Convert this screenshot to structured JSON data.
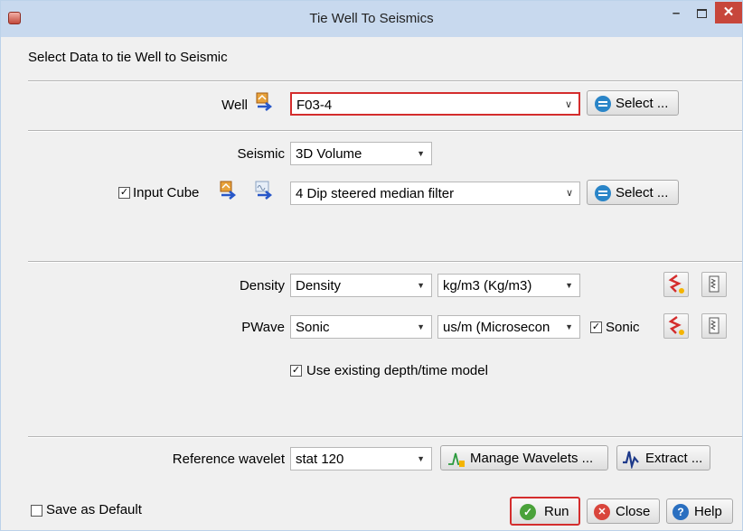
{
  "window": {
    "title": "Tie Well To Seismics",
    "minimize": "–",
    "close": "✕"
  },
  "header": "Select Data to tie Well to Seismic",
  "well": {
    "label": "Well",
    "value": "F03-4",
    "select_button": "Select ..."
  },
  "seismic": {
    "label": "Seismic",
    "value": "3D Volume",
    "input_cube": {
      "label": "Input Cube",
      "checked": true,
      "value": "4 Dip steered median filter",
      "select_button": "Select ..."
    }
  },
  "logs": {
    "density": {
      "label": "Density",
      "log": "Density",
      "unit": "kg/m3 (Kg/m3)"
    },
    "pwave": {
      "label": "PWave",
      "log": "Sonic",
      "unit": "us/m (Microsecon",
      "sonic_label": "Sonic",
      "sonic_checked": true
    },
    "use_existing_model": {
      "label": "Use existing depth/time model",
      "checked": true
    }
  },
  "wavelet": {
    "label": "Reference wavelet",
    "value": "stat 120",
    "manage_button": "Manage Wavelets ...",
    "extract_button": "Extract ..."
  },
  "footer": {
    "save_default": {
      "label": "Save as Default",
      "checked": false
    },
    "run": "Run",
    "close": "Close",
    "help": "Help"
  },
  "icons": {
    "app": "app-icon",
    "select": "list-icon",
    "well_input": "well-import-icon",
    "cube_input": "cube-import-icon",
    "segy_input": "segy-import-icon",
    "log_display": "log-display-icon",
    "log_props": "log-properties-icon",
    "wavelet": "wavelet-icon",
    "extract": "extract-wavelet-icon",
    "run": "checkmark-icon",
    "close": "close-icon",
    "help": "question-icon"
  },
  "colors": {
    "highlight": "#d42d2d",
    "accent": "#2a85c8",
    "run_green": "#4aa23a",
    "close_red": "#d9453c"
  }
}
